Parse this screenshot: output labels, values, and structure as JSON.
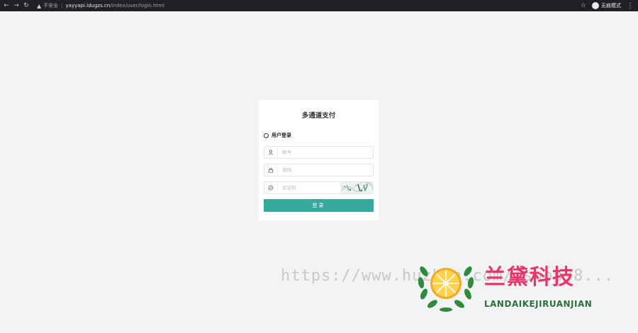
{
  "browser": {
    "back": "←",
    "forward": "→",
    "reload": "↻",
    "warning_icon": "warning-icon",
    "insecure_label": "不安全",
    "separator": "|",
    "url_host": "yayyapi.idugzs.cn",
    "url_path": "/index/user/login.html",
    "star": "☆",
    "incognito_label": "无痕模式",
    "menu": "⋮"
  },
  "card": {
    "title": "多通道支付",
    "section_title": "用户登录",
    "username_placeholder": "账号",
    "password_placeholder": "密码",
    "captcha_placeholder": "验证码",
    "login_label": "登录",
    "button_color": "#36a99a"
  },
  "watermark": {
    "url_text": "https://www.huzhan.com/1shop38...",
    "brand": "兰黛科技",
    "brand_sub": "LANDAIKEJIRUANJIAN",
    "brand_color": "#e8356b",
    "sub_color": "#2f6f3a"
  }
}
